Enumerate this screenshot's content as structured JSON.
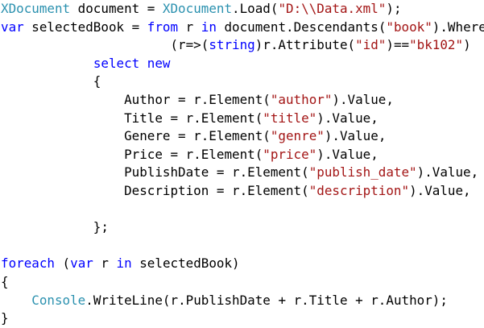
{
  "colors": {
    "type": "#2b91af",
    "keyword": "#0000ff",
    "string": "#a31515",
    "plain": "#000000"
  },
  "code_lines": [
    [
      [
        "XDocument",
        "t"
      ],
      [
        " document = ",
        "p"
      ],
      [
        "XDocument",
        "t"
      ],
      [
        ".Load(",
        "p"
      ],
      [
        "\"D:\\\\Data.xml\"",
        "s"
      ],
      [
        ");",
        "p"
      ]
    ],
    [
      [
        "var",
        "k"
      ],
      [
        " selectedBook = ",
        "p"
      ],
      [
        "from",
        "k"
      ],
      [
        " r ",
        "p"
      ],
      [
        "in",
        "k"
      ],
      [
        " document.Descendants(",
        "p"
      ],
      [
        "\"book\"",
        "s"
      ],
      [
        ").Where",
        "p"
      ]
    ],
    [
      [
        "                      (r=>(",
        "p"
      ],
      [
        "string",
        "k"
      ],
      [
        ")r.Attribute(",
        "p"
      ],
      [
        "\"id\"",
        "s"
      ],
      [
        ")==",
        "p"
      ],
      [
        "\"bk102\"",
        "s"
      ],
      [
        ")",
        "p"
      ]
    ],
    [
      [
        "            ",
        "p"
      ],
      [
        "select",
        "k"
      ],
      [
        " ",
        "p"
      ],
      [
        "new",
        "k"
      ]
    ],
    [
      [
        "            {",
        "p"
      ]
    ],
    [
      [
        "                Author = r.Element(",
        "p"
      ],
      [
        "\"author\"",
        "s"
      ],
      [
        ").Value,",
        "p"
      ]
    ],
    [
      [
        "                Title = r.Element(",
        "p"
      ],
      [
        "\"title\"",
        "s"
      ],
      [
        ").Value,",
        "p"
      ]
    ],
    [
      [
        "                Genere = r.Element(",
        "p"
      ],
      [
        "\"genre\"",
        "s"
      ],
      [
        ").Value,",
        "p"
      ]
    ],
    [
      [
        "                Price = r.Element(",
        "p"
      ],
      [
        "\"price\"",
        "s"
      ],
      [
        ").Value,",
        "p"
      ]
    ],
    [
      [
        "                PublishDate = r.Element(",
        "p"
      ],
      [
        "\"publish_date\"",
        "s"
      ],
      [
        ").Value,",
        "p"
      ]
    ],
    [
      [
        "                Description = r.Element(",
        "p"
      ],
      [
        "\"description\"",
        "s"
      ],
      [
        ").Value,",
        "p"
      ]
    ],
    [],
    [
      [
        "            };",
        "p"
      ]
    ],
    [],
    [
      [
        "foreach",
        "k"
      ],
      [
        " (",
        "p"
      ],
      [
        "var",
        "k"
      ],
      [
        " r ",
        "p"
      ],
      [
        "in",
        "k"
      ],
      [
        " selectedBook)",
        "p"
      ]
    ],
    [
      [
        "{",
        "p"
      ]
    ],
    [
      [
        "    ",
        "p"
      ],
      [
        "Console",
        "t"
      ],
      [
        ".WriteLine(r.PublishDate + r.Title + r.Author);",
        "p"
      ]
    ],
    [
      [
        "}",
        "p"
      ]
    ]
  ]
}
